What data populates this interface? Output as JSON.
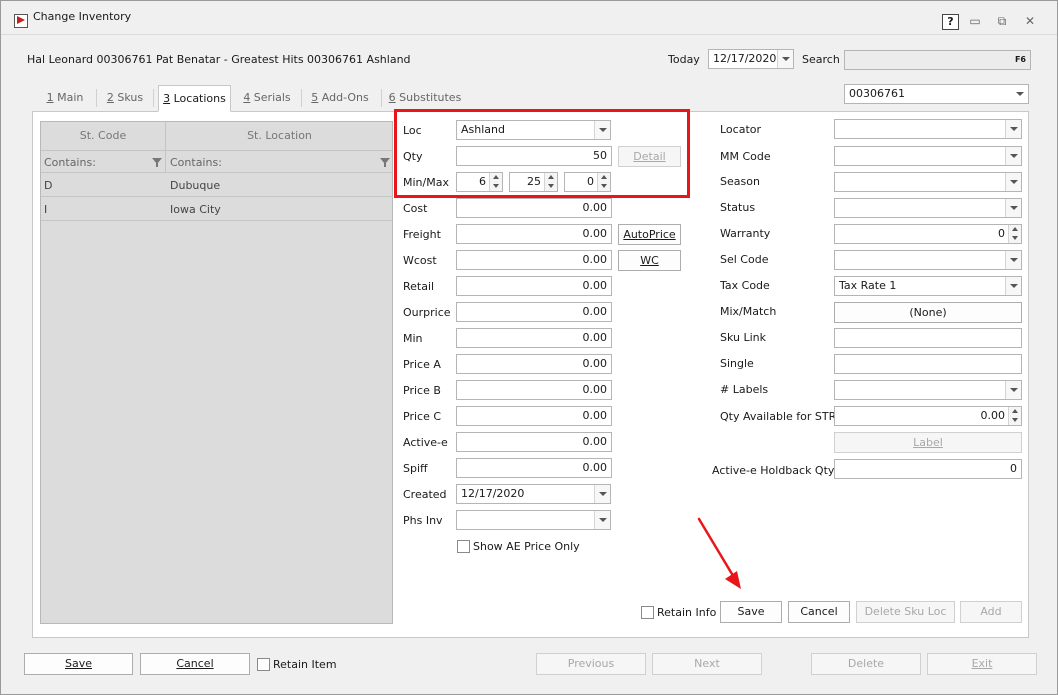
{
  "window": {
    "title": "Change Inventory",
    "help_label": "?",
    "minimize_glyph": "▭",
    "restore_glyph": "⧉",
    "close_glyph": "✕"
  },
  "header": {
    "item_description": "Hal Leonard 00306761 Pat Benatar - Greatest Hits 00306761 Ashland",
    "today_label": "Today",
    "today_value": "12/17/2020",
    "search_label": "Search",
    "search_key": "F6",
    "sku_value": "00306761"
  },
  "tabs": [
    {
      "key": "1",
      "label": " Main"
    },
    {
      "key": "2",
      "label": " Skus"
    },
    {
      "key": "3",
      "label": " Locations"
    },
    {
      "key": "4",
      "label": " Serials"
    },
    {
      "key": "5",
      "label": " Add-Ons"
    },
    {
      "key": "6",
      "label": " Substitutes"
    }
  ],
  "grid": {
    "columns": [
      "St. Code",
      "St. Location"
    ],
    "filter_label": "Contains:",
    "rows": [
      {
        "code": "D",
        "location": "Dubuque"
      },
      {
        "code": "I",
        "location": "Iowa City"
      }
    ]
  },
  "form_left": {
    "loc_label": "Loc",
    "loc_value": "Ashland",
    "qty_label": "Qty",
    "qty_value": "50",
    "detail_label": "Detail",
    "minmax_label": "Min/Max",
    "min_value": "6",
    "max_value": "25",
    "third_value": "0",
    "cost_label": "Cost",
    "cost_value": "0.00",
    "freight_label": "Freight",
    "freight_value": "0.00",
    "autoprice_label": "AutoPrice",
    "wcost_label": "Wcost",
    "wcost_value": "0.00",
    "wc_label": "WC",
    "retail_label": "Retail",
    "retail_value": "0.00",
    "ourprice_label": "Ourprice",
    "ourprice_value": "0.00",
    "min_label": "Min",
    "min_price_value": "0.00",
    "pricea_label": "Price A",
    "pricea_value": "0.00",
    "priceb_label": "Price B",
    "priceb_value": "0.00",
    "pricec_label": "Price C",
    "pricec_value": "0.00",
    "activee_label": "Active-e",
    "activee_value": "0.00",
    "spiff_label": "Spiff",
    "spiff_value": "0.00",
    "created_label": "Created",
    "created_value": "12/17/2020",
    "phsinv_label": "Phs Inv",
    "phsinv_value": "",
    "show_ae_label": "Show AE Price Only"
  },
  "form_right": {
    "locator_label": "Locator",
    "mmcode_label": "MM Code",
    "season_label": "Season",
    "status_label": "Status",
    "warranty_label": "Warranty",
    "warranty_value": "0",
    "selcode_label": "Sel Code",
    "taxcode_label": "Tax Code",
    "taxcode_value": "Tax Rate 1",
    "mixmatch_label": "Mix/Match",
    "mixmatch_value": "(None)",
    "skulink_label": "Sku Link",
    "single_label": "Single",
    "labels_label": "# Labels",
    "qtystr_label": "Qty Available for STR",
    "qtystr_value": "0.00",
    "label_button": "Label",
    "holdback_label": "Active-e Holdback Qty",
    "holdback_value": "0"
  },
  "panel_actions": {
    "retain_info": "Retain Info",
    "save": "Save",
    "cancel": "Cancel",
    "delete_sku_loc": "Delete Sku Loc",
    "add": "Add"
  },
  "footer": {
    "save": "Save",
    "cancel": "Cancel",
    "retain_item": "Retain Item",
    "previous": "Previous",
    "next": "Next",
    "delete": "Delete",
    "exit": "Exit"
  },
  "annotation_colors": {
    "highlight": "#e8161b"
  }
}
